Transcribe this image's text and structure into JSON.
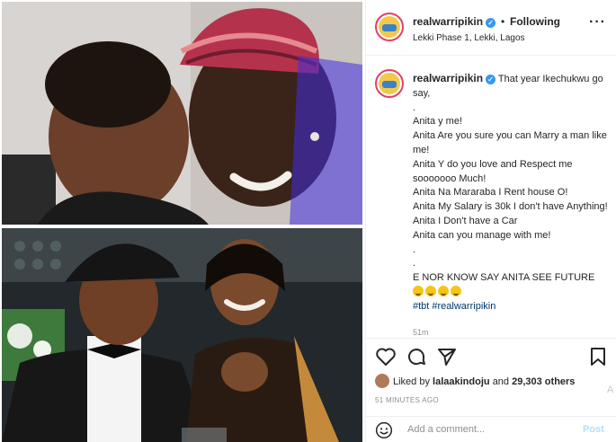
{
  "post": {
    "username": "realwarripikin",
    "verified_icon": "verified-badge-icon",
    "separator": "•",
    "follow_status": "Following",
    "location": "Lekki Phase 1, Lekki, Lagos",
    "more_icon": "more-options-icon"
  },
  "caption": {
    "username": "realwarripikin",
    "lines": [
      "That year Ikechukwu go say,",
      ".",
      "Anita y me!",
      "Anita Are you sure you can Marry a man like me!",
      "Anita Y do you love and Respect me sooooooo Much!",
      "Anita Na Mararaba I Rent house O!",
      "Anita My Salary is 30k I don't have Anything!",
      "Anita I Don't have a Car",
      "Anita can you manage with me!",
      ".",
      ".",
      "E NOR KNOW SAY ANITA SEE FUTURE"
    ],
    "emoji_icon": "laughing-tears-emoji",
    "emoji_count": 4,
    "hashtags": "#tbt #realwarripikin",
    "time_small": "51m"
  },
  "actions": {
    "like_icon": "heart-icon",
    "comment_icon": "comment-icon",
    "share_icon": "share-icon",
    "save_icon": "bookmark-icon"
  },
  "likes": {
    "prefix": "Liked by",
    "user": "lalaakindoju",
    "and": "and",
    "count_text": "29,303 others"
  },
  "timestamp": "51 MINUTES AGO",
  "stray_char": "A",
  "comment_box": {
    "emoji_icon": "smiley-icon",
    "placeholder": "Add a comment...",
    "post_label": "Post"
  },
  "colors": {
    "verified": "#3897f0",
    "link": "#00376b",
    "post_disabled": "#b2dffc",
    "muted": "#8e8e8e"
  }
}
